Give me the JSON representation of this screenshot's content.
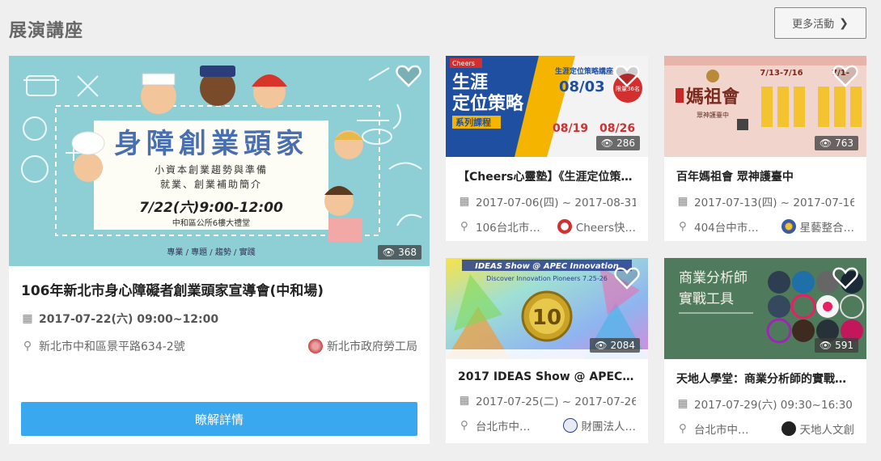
{
  "section": {
    "title": "展演講座",
    "more_label": "更多活動"
  },
  "featured": {
    "title": "106年新北市身心障礙者創業頭家宣導會(中和場)",
    "date": "2017-07-22(六) 09:00~12:00",
    "location": "新北市中和區景平路634-2號",
    "organizer": "新北市政府勞工局",
    "views": "368",
    "cta_label": "瞭解詳情",
    "poster": {
      "headline": "身障創業頭家",
      "line1": "小資本創業趨勢與準備",
      "line2": "就業、創業補助簡介",
      "time": "7/22(六)9:00-12:00",
      "venue": "中和區公所6樓大禮堂",
      "footer": "專業 / 專題 / 趨勢 / 實踐"
    }
  },
  "events": [
    {
      "title": "【Cheers心靈塾】《生涯定位策…",
      "date": "2017-07-06(四) ~ 2017-08-31…",
      "location": "106台北市…",
      "organizer": "Cheers快…",
      "views": "286",
      "poster": {
        "brand": "Cheers",
        "headline1": "生涯",
        "headline2": "定位策略",
        "sub": "系列課程",
        "right1": "生涯定位策略講座",
        "date1": "08/03",
        "date2": "08/19",
        "date3": "08/26",
        "badge": "限量36名"
      }
    },
    {
      "title": "百年媽祖會 眾神護臺中",
      "date": "2017-07-13(四) ~ 2017-07-16…",
      "location": "404台中市…",
      "organizer": "星藝整合…",
      "views": "763",
      "poster": {
        "headline": "媽祖會",
        "sub": "眾神護臺中",
        "d1": "7/13-7/16",
        "d2": "7/1-"
      }
    },
    {
      "title": "2017 IDEAS Show @ APEC Inn…",
      "date": "2017-07-25(二) ~ 2017-07-26…",
      "location": "台北市中…",
      "organizer": "財團法人…",
      "views": "2084",
      "poster": {
        "headline": "IDEAS Show @ APEC Innovation",
        "sub": "Discover Innovation Pioneers 7.25-26",
        "badge": "10"
      }
    },
    {
      "title": "天地人學堂：商業分析師的實戰…",
      "date": "2017-07-29(六) 09:30~16:30",
      "location": "台北市中…",
      "organizer": "天地人文創",
      "views": "591",
      "poster": {
        "headline1": "商業分析師",
        "headline2": "實戰工具"
      }
    }
  ],
  "colors": {
    "accent": "#3aa8ee",
    "background": "#efefef"
  }
}
